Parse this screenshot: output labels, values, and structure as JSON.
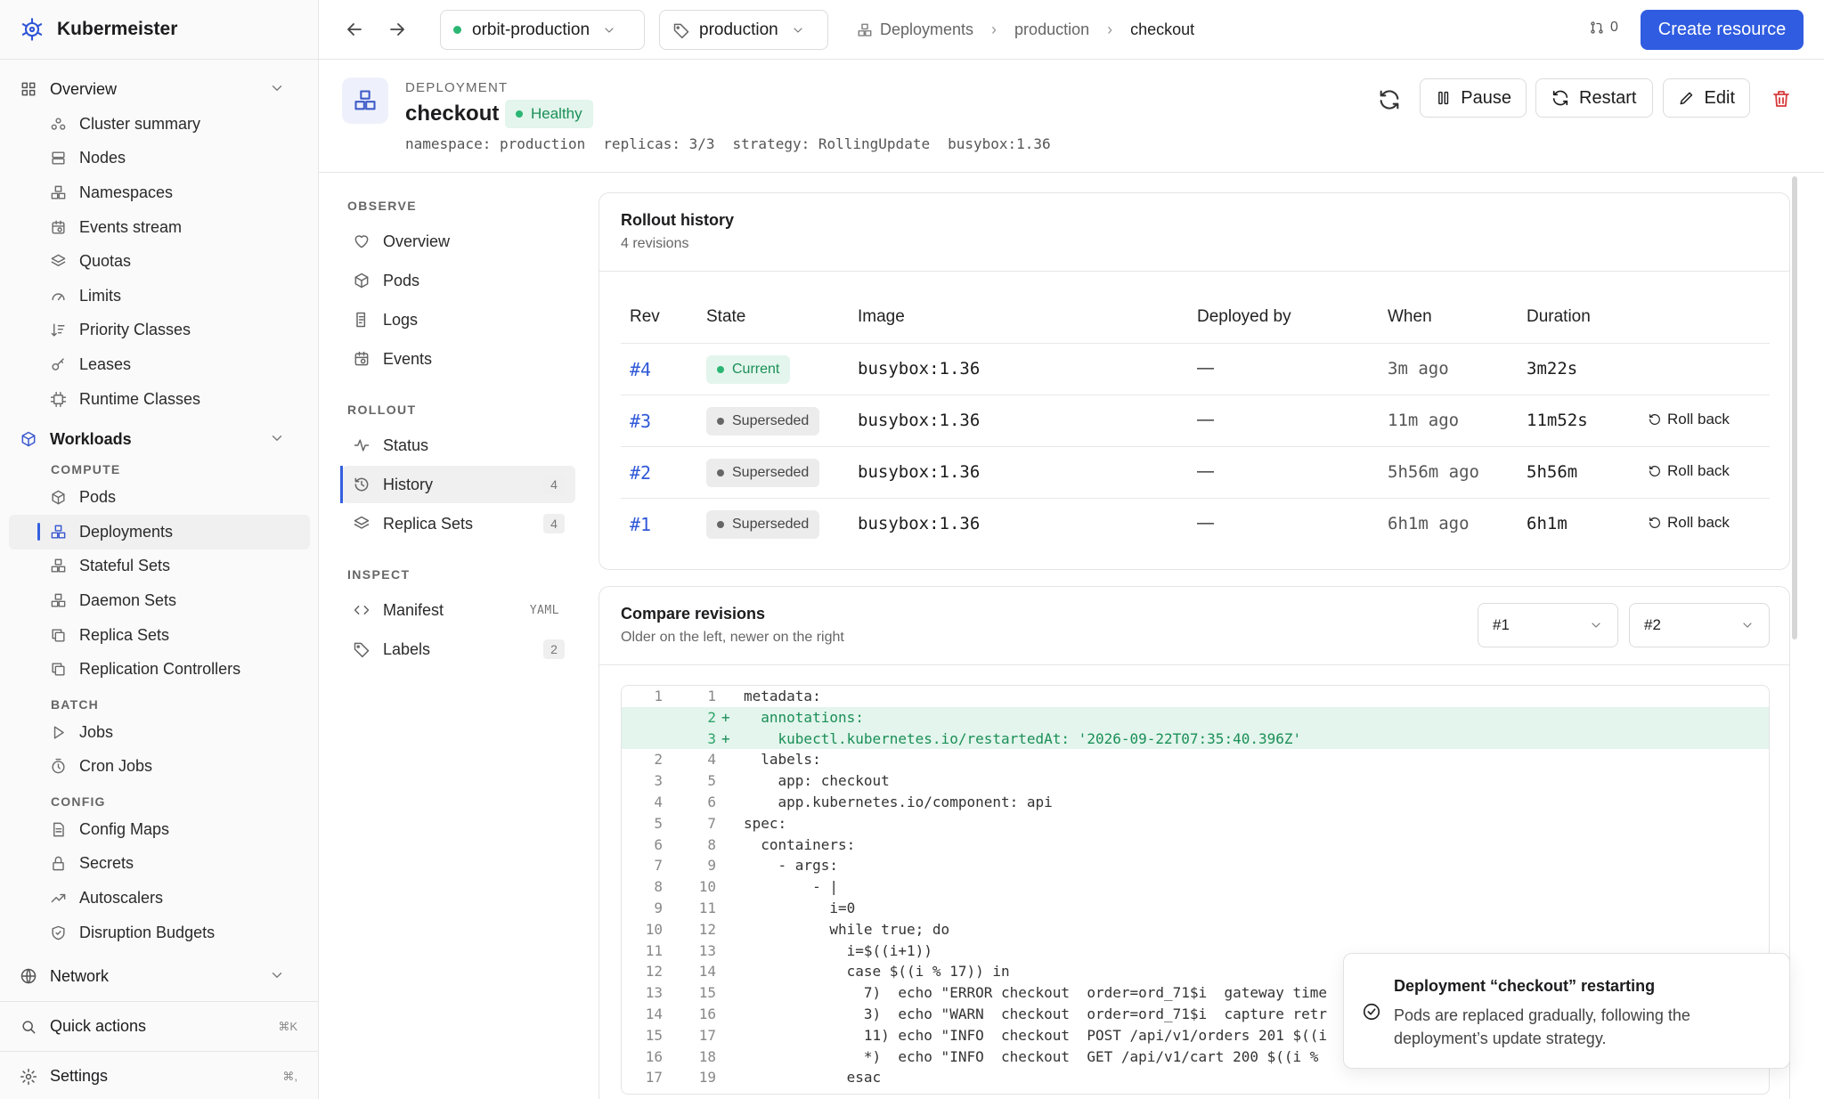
{
  "app": {
    "name": "Kubermeister"
  },
  "sidebar": {
    "overview": {
      "label": "Overview",
      "items": [
        "Cluster summary",
        "Nodes",
        "Namespaces",
        "Events stream",
        "Quotas",
        "Limits",
        "Priority Classes",
        "Leases",
        "Runtime Classes"
      ]
    },
    "workloads": {
      "label": "Workloads",
      "groups": {
        "compute": {
          "label": "COMPUTE",
          "items": [
            "Pods",
            "Deployments",
            "Stateful Sets",
            "Daemon Sets",
            "Replica Sets",
            "Replication Controllers"
          ]
        },
        "batch": {
          "label": "BATCH",
          "items": [
            "Jobs",
            "Cron Jobs"
          ]
        },
        "config": {
          "label": "CONFIG",
          "items": [
            "Config Maps",
            "Secrets",
            "Autoscalers",
            "Disruption Budgets"
          ]
        }
      }
    },
    "network": {
      "label": "Network"
    },
    "quick_actions": {
      "label": "Quick actions",
      "shortcut": "⌘K"
    },
    "settings": {
      "label": "Settings",
      "shortcut": "⌘,"
    }
  },
  "topbar": {
    "cluster": "orbit-production",
    "namespace": "production",
    "breadcrumbs": [
      "Deployments",
      "production",
      "checkout"
    ],
    "notifications_count": "0",
    "create_label": "Create resource"
  },
  "resource": {
    "kind": "DEPLOYMENT",
    "name": "checkout",
    "health": "Healthy",
    "meta": [
      "namespace: production",
      "replicas: 3/3",
      "strategy: RollingUpdate",
      "busybox:1.36"
    ],
    "actions": {
      "pause": "Pause",
      "restart": "Restart",
      "edit": "Edit"
    }
  },
  "subnav": {
    "observe": {
      "label": "OBSERVE",
      "items": [
        "Overview",
        "Pods",
        "Logs",
        "Events"
      ]
    },
    "rollout": {
      "label": "ROLLOUT",
      "items": [
        "Status",
        "History",
        "Replica Sets"
      ],
      "badges": {
        "history": "4",
        "replica_sets": "4"
      }
    },
    "inspect": {
      "label": "INSPECT",
      "items": [
        "Manifest",
        "Labels"
      ],
      "badges": {
        "manifest": "YAML",
        "labels": "2"
      }
    }
  },
  "rollout_history": {
    "title": "Rollout history",
    "subtitle": "4 revisions",
    "columns": [
      "Rev",
      "State",
      "Image",
      "Deployed by",
      "When",
      "Duration"
    ],
    "rows": [
      {
        "rev": "#4",
        "state": "Current",
        "image": "busybox:1.36",
        "by": "—",
        "when": "3m ago",
        "duration": "3m22s",
        "action": ""
      },
      {
        "rev": "#3",
        "state": "Superseded",
        "image": "busybox:1.36",
        "by": "—",
        "when": "11m ago",
        "duration": "11m52s",
        "action": "Roll back"
      },
      {
        "rev": "#2",
        "state": "Superseded",
        "image": "busybox:1.36",
        "by": "—",
        "when": "5h56m ago",
        "duration": "5h56m",
        "action": "Roll back"
      },
      {
        "rev": "#1",
        "state": "Superseded",
        "image": "busybox:1.36",
        "by": "—",
        "when": "6h1m ago",
        "duration": "6h1m",
        "action": "Roll back"
      }
    ]
  },
  "compare": {
    "title": "Compare revisions",
    "subtitle": "Older on the left, newer on the right",
    "left": "#1",
    "right": "#2",
    "lines": [
      {
        "a": "1",
        "b": "1",
        "m": "",
        "t": "metadata:"
      },
      {
        "a": "",
        "b": "2",
        "m": "+",
        "t": "  annotations:"
      },
      {
        "a": "",
        "b": "3",
        "m": "+",
        "t": "    kubectl.kubernetes.io/restartedAt: '2026-09-22T07:35:40.396Z'"
      },
      {
        "a": "2",
        "b": "4",
        "m": "",
        "t": "  labels:"
      },
      {
        "a": "3",
        "b": "5",
        "m": "",
        "t": "    app: checkout"
      },
      {
        "a": "4",
        "b": "6",
        "m": "",
        "t": "    app.kubernetes.io/component: api"
      },
      {
        "a": "5",
        "b": "7",
        "m": "",
        "t": "spec:"
      },
      {
        "a": "6",
        "b": "8",
        "m": "",
        "t": "  containers:"
      },
      {
        "a": "7",
        "b": "9",
        "m": "",
        "t": "    - args:"
      },
      {
        "a": "8",
        "b": "10",
        "m": "",
        "t": "        - |"
      },
      {
        "a": "9",
        "b": "11",
        "m": "",
        "t": "          i=0"
      },
      {
        "a": "10",
        "b": "12",
        "m": "",
        "t": "          while true; do"
      },
      {
        "a": "11",
        "b": "13",
        "m": "",
        "t": "            i=$((i+1))"
      },
      {
        "a": "12",
        "b": "14",
        "m": "",
        "t": "            case $((i % 17)) in"
      },
      {
        "a": "13",
        "b": "15",
        "m": "",
        "t": "              7)  echo \"ERROR checkout  order=ord_71$i  gateway time"
      },
      {
        "a": "14",
        "b": "16",
        "m": "",
        "t": "              3)  echo \"WARN  checkout  order=ord_71$i  capture retr"
      },
      {
        "a": "15",
        "b": "17",
        "m": "",
        "t": "              11) echo \"INFO  checkout  POST /api/v1/orders 201 $((i"
      },
      {
        "a": "16",
        "b": "18",
        "m": "",
        "t": "              *)  echo \"INFO  checkout  GET /api/v1/cart 200 $((i %"
      },
      {
        "a": "17",
        "b": "19",
        "m": "",
        "t": "            esac"
      }
    ]
  },
  "toast": {
    "title": "Deployment “checkout” restarting",
    "body": "Pods are replaced gradually, following the deployment’s update strategy."
  }
}
